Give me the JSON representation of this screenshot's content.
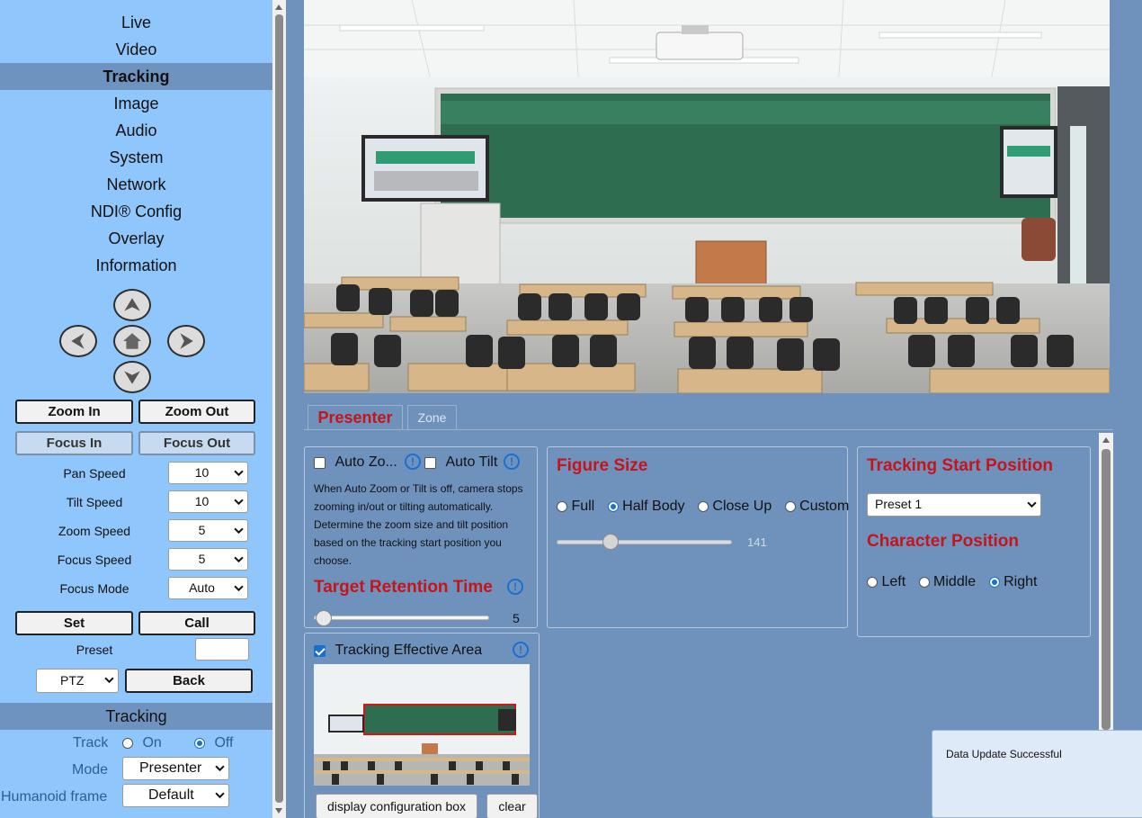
{
  "nav": [
    "Live",
    "Video",
    "Tracking",
    "Image",
    "Audio",
    "System",
    "Network",
    "NDI® Config",
    "Overlay",
    "Information"
  ],
  "nav_active": "Tracking",
  "ptz": {
    "up": "arrow-up-icon",
    "left": "arrow-left-icon",
    "home": "home-icon",
    "right": "arrow-right-icon",
    "down": "arrow-down-icon"
  },
  "zoom": {
    "in": "Zoom In",
    "out": "Zoom Out"
  },
  "focus": {
    "in": "Focus In",
    "out": "Focus Out"
  },
  "params": [
    {
      "label": "Pan Speed",
      "value": "10"
    },
    {
      "label": "Tilt Speed",
      "value": "10"
    },
    {
      "label": "Zoom Speed",
      "value": "5"
    },
    {
      "label": "Focus Speed",
      "value": "5"
    },
    {
      "label": "Focus Mode",
      "value": "Auto"
    }
  ],
  "preset": {
    "set": "Set",
    "call": "Call",
    "label": "Preset",
    "value": "",
    "mode": "PTZ",
    "back": "Back"
  },
  "tracking": {
    "title": "Tracking",
    "track_label": "Track",
    "on": "On",
    "off": "Off",
    "track_value": "Off",
    "mode_label": "Mode",
    "mode_value": "Presenter",
    "humanoid_label": "Humanoid frame",
    "humanoid_value": "Default"
  },
  "tabs": [
    "Presenter",
    "Zone"
  ],
  "tab_active": "Presenter",
  "auto": {
    "zoom_label": "Auto Zo...",
    "zoom_checked": false,
    "tilt_label": "Auto Tilt",
    "tilt_checked": false,
    "description": "When Auto Zoom or Tilt is off, camera stops zooming in/out or tilting automatically. Determine the zoom size and tilt position based on the tracking start position you choose."
  },
  "retention": {
    "title": "Target Retention Time",
    "value": "5",
    "min": 0,
    "max": 100
  },
  "effective_area": {
    "label": "Tracking Effective Area",
    "checked": true,
    "display_btn": "display configuration box",
    "clear_btn": "clear"
  },
  "figure": {
    "title": "Figure Size",
    "options": [
      "Full",
      "Half Body",
      "Close Up",
      "Custom"
    ],
    "selected": "Half Body",
    "value": "141",
    "level": 0.3
  },
  "start_position": {
    "title": "Tracking Start Position",
    "value": "Preset 1"
  },
  "character": {
    "title": "Character Position",
    "options": [
      "Left",
      "Middle",
      "Right"
    ],
    "selected": "Right"
  },
  "toast": "Data Update Successful",
  "colors": {
    "accent_red": "#c5141a",
    "sidebar": "#8fc6fb",
    "main_bg": "#6f92bd",
    "active_nav": "#6e93bf"
  }
}
